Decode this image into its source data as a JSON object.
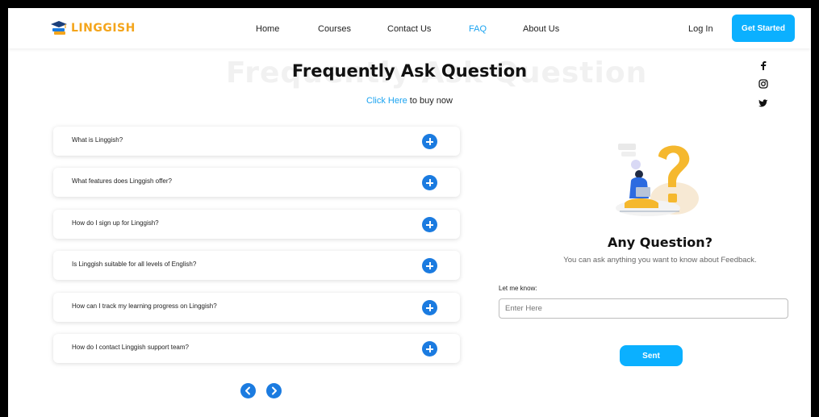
{
  "brand": {
    "name": "LINGGISH"
  },
  "nav": {
    "items": [
      {
        "label": "Home"
      },
      {
        "label": "Courses"
      },
      {
        "label": "Contact Us"
      },
      {
        "label": "FAQ"
      },
      {
        "label": "About Us"
      }
    ],
    "active": "FAQ",
    "login": "Log In",
    "cta": "Get Started"
  },
  "faq": {
    "background_title": "Frequently Ask Question",
    "title": "Frequently Ask Question",
    "subtitle_link": "Click Here",
    "subtitle_rest": " to buy now",
    "questions": [
      "What is Linggish?",
      "What features does Linggish offer?",
      "How do I sign up for Linggish?",
      "Is Linggish suitable for all levels of English?",
      "How can I track my learning progress on Linggish?",
      "How do I contact Linggish support team?"
    ]
  },
  "social": [
    "facebook-icon",
    "instagram-icon",
    "twitter-icon"
  ],
  "question_panel": {
    "title": "Any Question?",
    "subtitle": "You can ask anything you want to know about Feedback.",
    "label": "Let me know:",
    "placeholder": "Enter Here",
    "submit": "Sent"
  },
  "colors": {
    "accent": "#0bb0ff",
    "link": "#1aa3f0",
    "icon_blue": "#1b7be0",
    "logo_gold": "#f4a51c"
  }
}
